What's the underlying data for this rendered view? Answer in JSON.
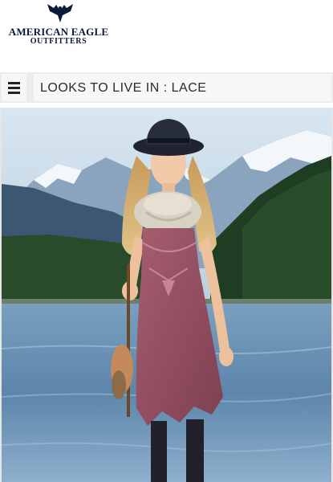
{
  "brand": {
    "name_line1": "AMERICAN EAGLE",
    "name_line2": "OUTFITTERS",
    "logo_icon": "eagle-icon",
    "color": "#0b1a3a"
  },
  "nav": {
    "menu_icon": "hamburger-menu-icon",
    "page_title": "LOOKS TO LIVE IN : LACE"
  },
  "hero": {
    "subject": "model in lace dress by lake with mountains"
  },
  "colors": {
    "title_bar_bg": "#ececec",
    "title_text": "#2b2b2b",
    "dress": "#9a5466",
    "sky": "#c9dbe8",
    "water": "#5d86ab",
    "forest": "#1f3d22"
  }
}
